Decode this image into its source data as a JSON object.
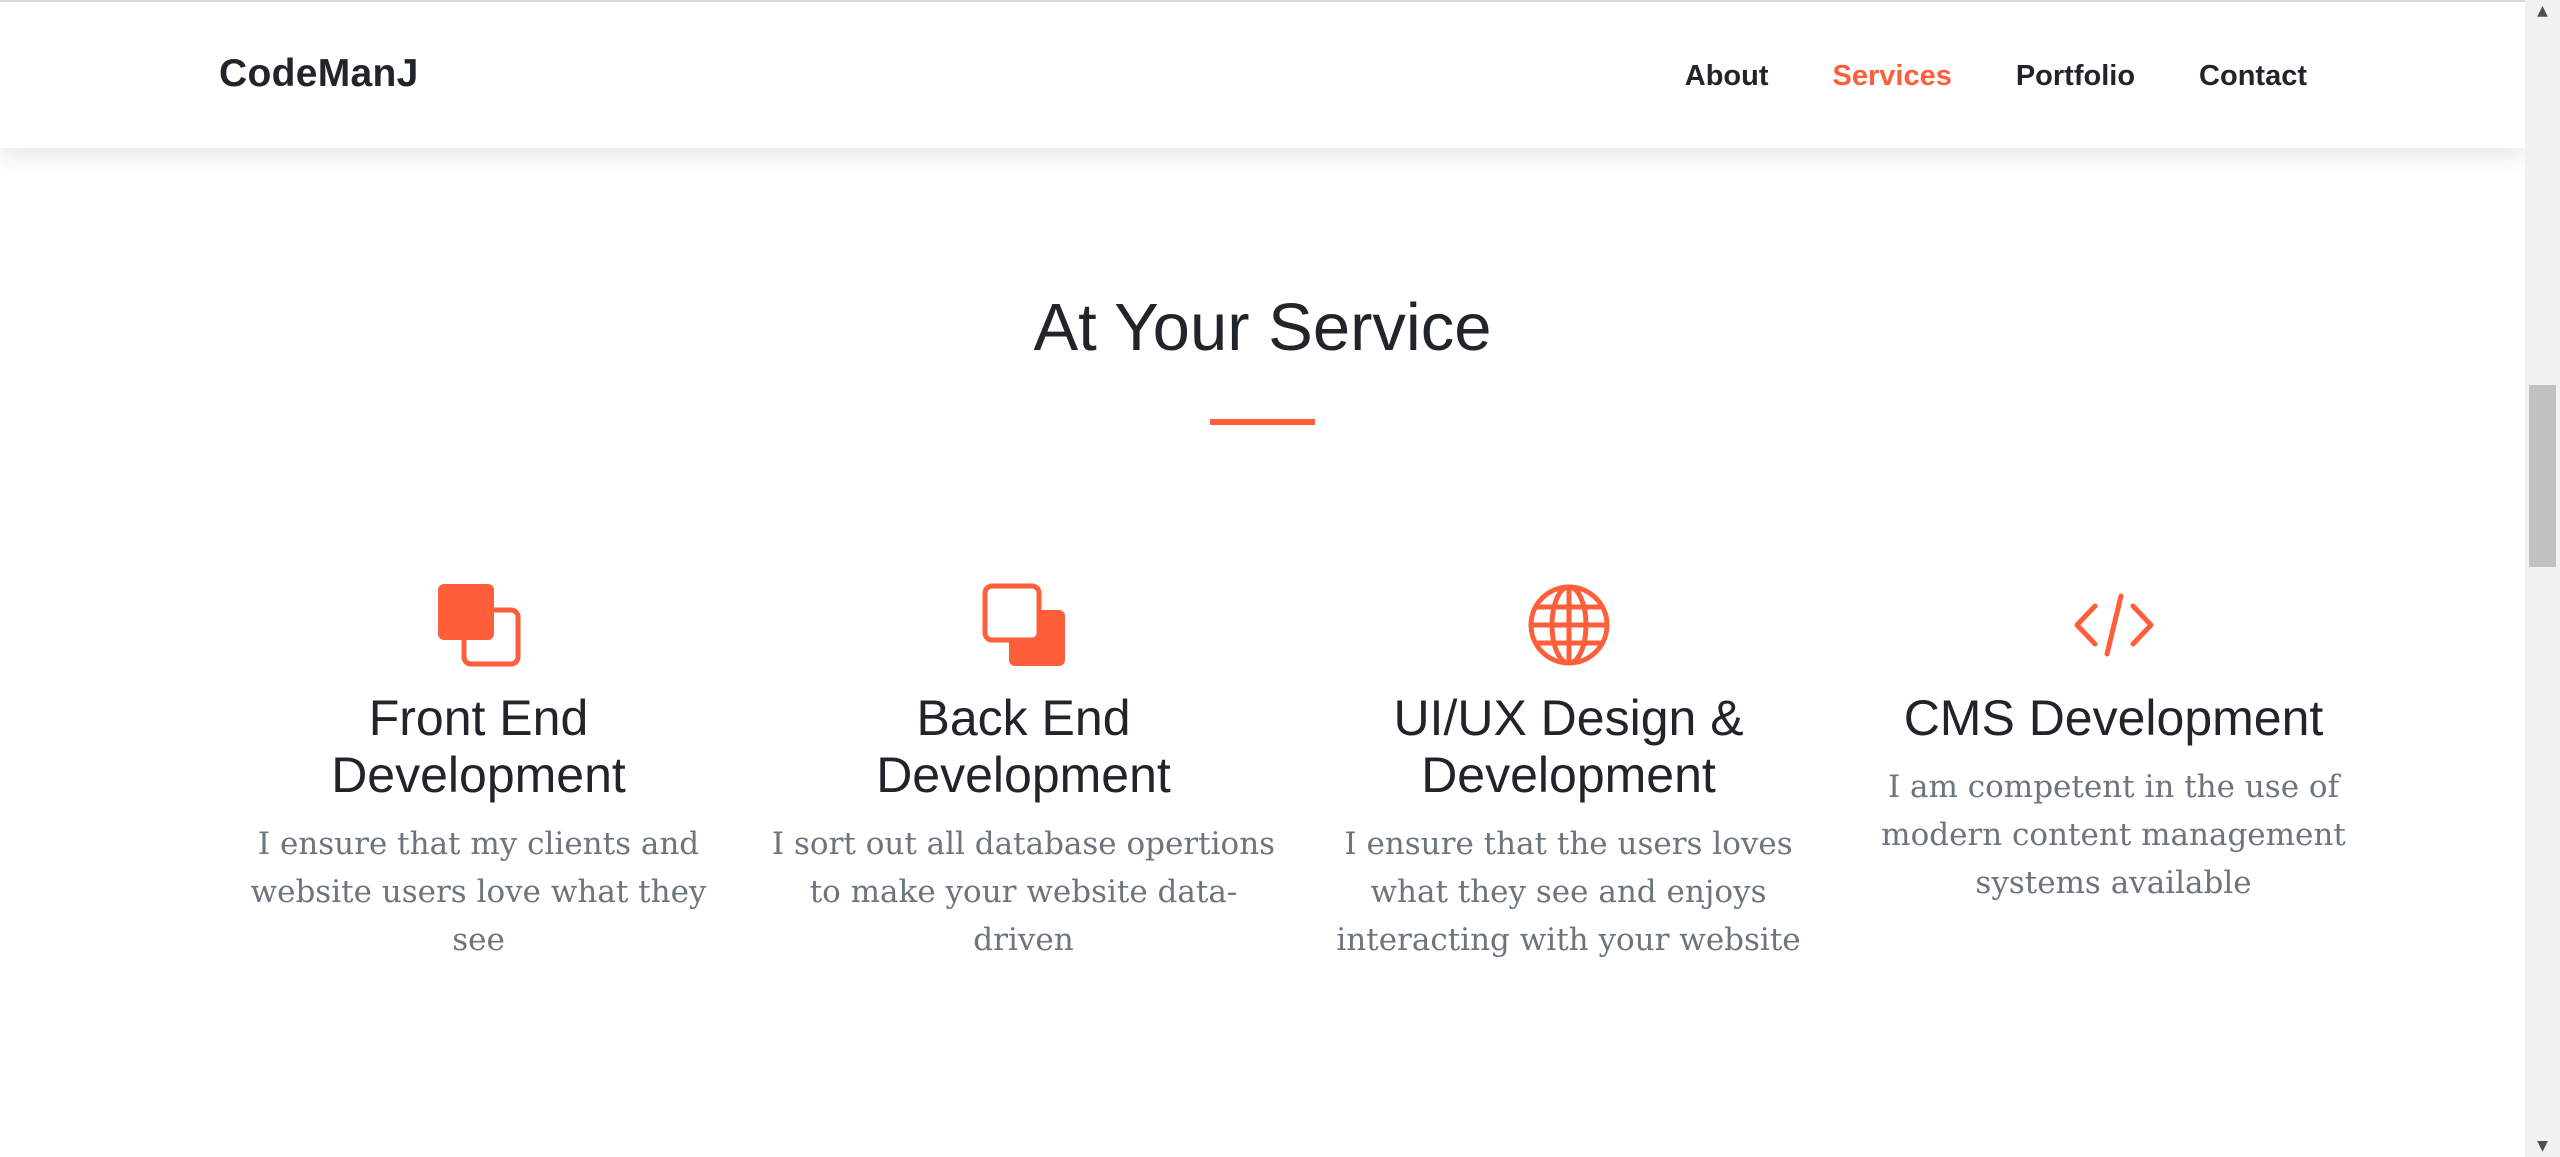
{
  "nav": {
    "brand": "CodeManJ",
    "links": [
      {
        "label": "About",
        "active": false
      },
      {
        "label": "Services",
        "active": true
      },
      {
        "label": "Portfolio",
        "active": false
      },
      {
        "label": "Contact",
        "active": false
      }
    ]
  },
  "section": {
    "title": "At Your Service"
  },
  "services": [
    {
      "icon": "front-end-stacked-squares-icon",
      "title_line1": "Front End",
      "title_line2": "Development",
      "description": "I ensure that my clients and website users love what they see"
    },
    {
      "icon": "back-end-stacked-squares-icon",
      "title_line1": "Back End",
      "title_line2": "Development",
      "description": "I sort out all database opertions to make your website data-driven"
    },
    {
      "icon": "globe-icon",
      "title_line1": "UI/UX Design &",
      "title_line2": "Development",
      "description": "I ensure that the users loves what they see and enjoys interacting with your website"
    },
    {
      "icon": "code-icon",
      "title_line1": "CMS Development",
      "title_line2": "",
      "description": "I am competent in the use of modern content management systems available"
    }
  ],
  "colors": {
    "accent": "#ff5e3a",
    "heading": "#212529",
    "muted_text": "#6c757d",
    "background": "#ffffff"
  }
}
